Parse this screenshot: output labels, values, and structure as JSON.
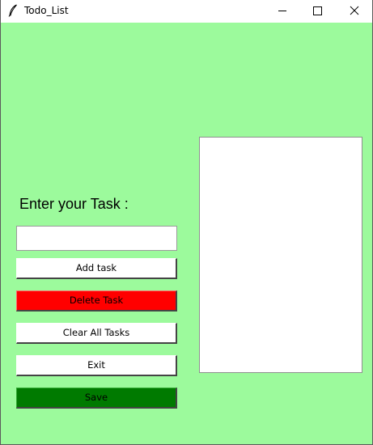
{
  "window": {
    "title": "Todo_List",
    "icon": "feather-icon",
    "controls": [
      "minimize-icon",
      "maximize-icon",
      "close-icon"
    ]
  },
  "form": {
    "prompt": "Enter your Task :",
    "entry_value": ""
  },
  "buttons": {
    "add": "Add task",
    "delete": "Delete Task",
    "clear": "Clear All Tasks",
    "exit": "Exit",
    "save": "Save"
  },
  "tasks": [],
  "colors": {
    "background": "#9cfa9c",
    "delete_button": "#ff0000",
    "save_button": "#007a00",
    "default_button": "#ffffff"
  }
}
